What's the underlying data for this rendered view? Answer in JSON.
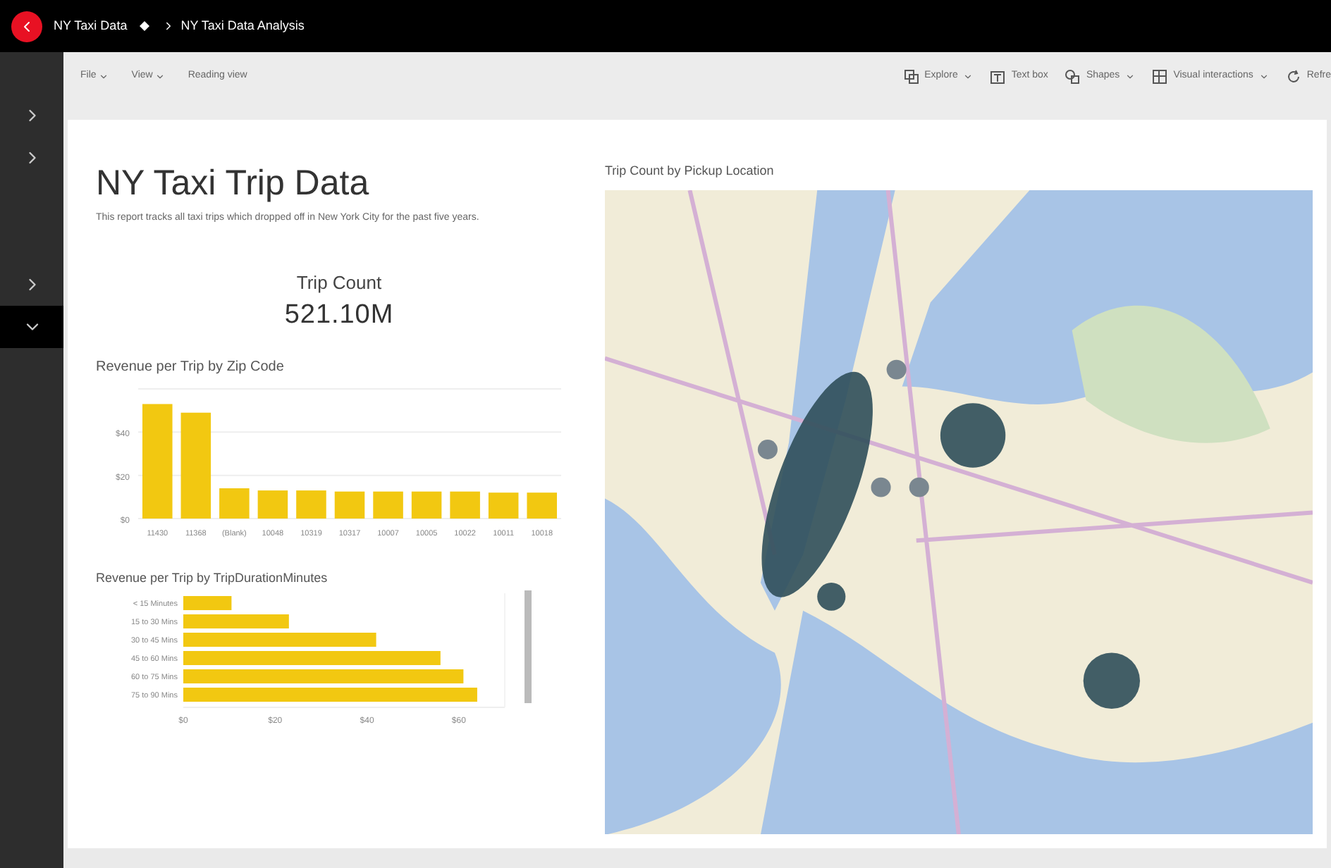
{
  "header": {
    "workspace": "NY Taxi Data",
    "report": "NY Taxi Data Analysis"
  },
  "toolbar": {
    "left": [
      {
        "label": "File",
        "dropdown": true
      },
      {
        "label": "View",
        "dropdown": true
      },
      {
        "label": "Reading view",
        "dropdown": false
      }
    ],
    "right": [
      {
        "label": "Explore",
        "kind": "explore",
        "dropdown": true
      },
      {
        "label": "Text box",
        "kind": "textbox",
        "dropdown": false
      },
      {
        "label": "Shapes",
        "kind": "shapes",
        "dropdown": true
      },
      {
        "label": "Visual interactions",
        "kind": "interactions",
        "dropdown": true
      },
      {
        "label": "Refre",
        "kind": "refresh",
        "dropdown": false
      }
    ]
  },
  "rail": [
    {
      "expanded": false
    },
    {
      "expanded": false
    },
    {
      "expanded": false
    },
    {
      "expanded": true
    }
  ],
  "report": {
    "title": "NY Taxi Trip Data",
    "description": "This report tracks all taxi trips which dropped off in New York City for the past five years.",
    "card": {
      "label": "Trip Count",
      "value": "521.10M"
    },
    "zip_chart": {
      "title": "Revenue per Trip by Zip Code",
      "chart_data": {
        "type": "bar",
        "categories": [
          "11430",
          "11368",
          "(Blank)",
          "10048",
          "10319",
          "10317",
          "10007",
          "10005",
          "10022",
          "10011",
          "10018"
        ],
        "series": [
          {
            "color": "#f2c811",
            "values": [
              53,
              49,
              14,
              13,
              13,
              12.5,
              12.5,
              12.5,
              12.5,
              12,
              12
            ]
          }
        ],
        "ylim": [
          0,
          60
        ],
        "yticks": [
          {
            "value": 0,
            "label": "$0"
          },
          {
            "value": 20,
            "label": "$20"
          },
          {
            "value": 40,
            "label": "$40"
          }
        ]
      }
    },
    "duration_chart": {
      "title": "Revenue per Trip by TripDurationMinutes",
      "chart_data": {
        "type": "bar",
        "orientation": "horizontal",
        "categories": [
          "< 15 Minutes",
          "15 to 30 Mins",
          "30 to 45 Mins",
          "45 to 60 Mins",
          "60 to 75 Mins",
          "75 to 90 Mins"
        ],
        "series": [
          {
            "color": "#f2c811",
            "values": [
              10.5,
              23,
              42,
              56,
              61,
              64
            ]
          }
        ],
        "xlim": [
          0,
          70
        ],
        "xticks": [
          {
            "value": 0,
            "label": "$0"
          },
          {
            "value": 20,
            "label": "$20"
          },
          {
            "value": 40,
            "label": "$40"
          },
          {
            "value": 60,
            "label": "$60"
          }
        ]
      }
    },
    "map": {
      "title": "Trip Count by Pickup Location"
    }
  }
}
